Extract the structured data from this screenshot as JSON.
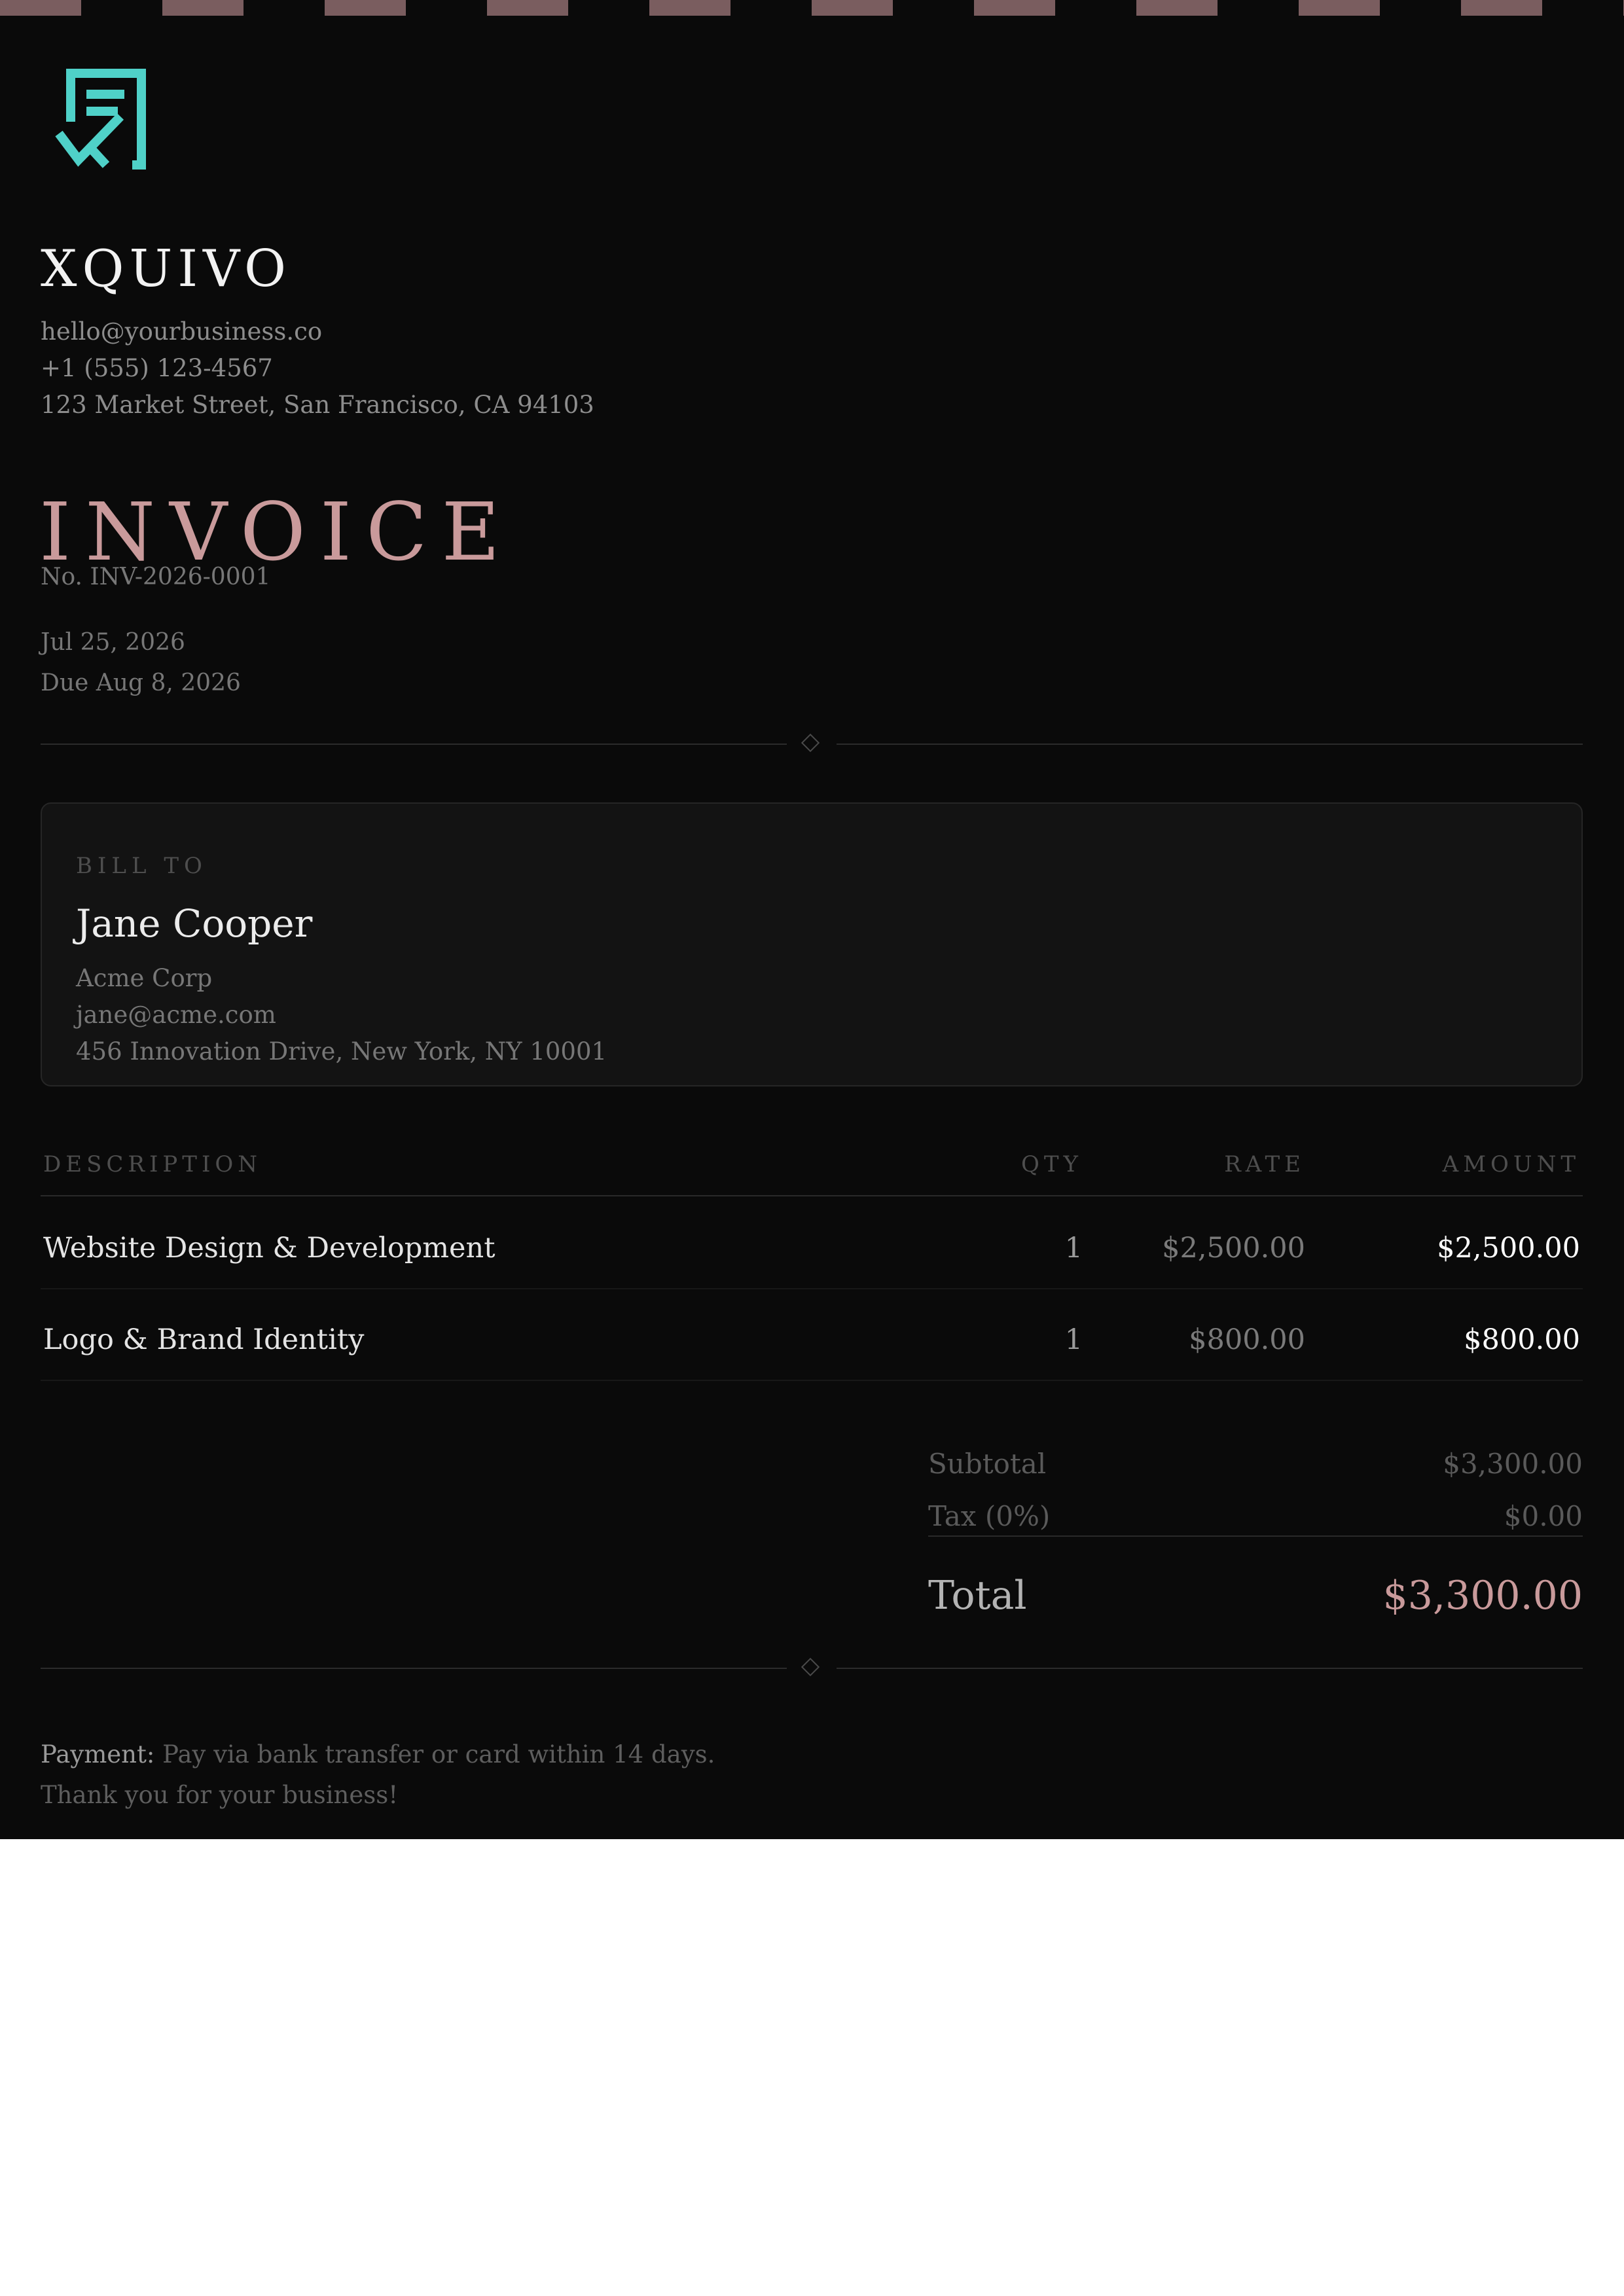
{
  "colors": {
    "background": "#0a0a0a",
    "accent": "#c99a9b",
    "logo": "#4fd1c8",
    "stripe": "#7a5d5f"
  },
  "business": {
    "logo_icon": "receipt-check-icon",
    "name": "XQUIVO",
    "email": "hello@yourbusiness.co",
    "phone": "+1 (555) 123-4567",
    "address": "123 Market Street, San Francisco, CA 94103"
  },
  "invoice": {
    "title": "INVOICE",
    "number": "No. INV-2026-0001",
    "date": "Jul 25, 2026",
    "due": "Due Aug 8, 2026"
  },
  "bill_to": {
    "label": "BILL TO",
    "name": "Jane Cooper",
    "company": "Acme Corp",
    "email": "jane@acme.com",
    "address": "456 Innovation Drive, New York, NY 10001"
  },
  "table": {
    "headers": {
      "description": "DESCRIPTION",
      "qty": "QTY",
      "rate": "RATE",
      "amount": "AMOUNT"
    },
    "rows": [
      {
        "description": "Website Design & Development",
        "qty": "1",
        "rate": "$2,500.00",
        "amount": "$2,500.00"
      },
      {
        "description": "Logo & Brand Identity",
        "qty": "1",
        "rate": "$800.00",
        "amount": "$800.00"
      }
    ]
  },
  "totals": {
    "subtotal_label": "Subtotal",
    "subtotal_value": "$3,300.00",
    "tax_label": "Tax (0%)",
    "tax_value": "$0.00",
    "total_label": "Total",
    "total_value": "$3,300.00"
  },
  "footer": {
    "payment_label": "Payment:",
    "payment_text": "Pay via bank transfer or card within 14 days.",
    "thanks": "Thank you for your business!"
  }
}
